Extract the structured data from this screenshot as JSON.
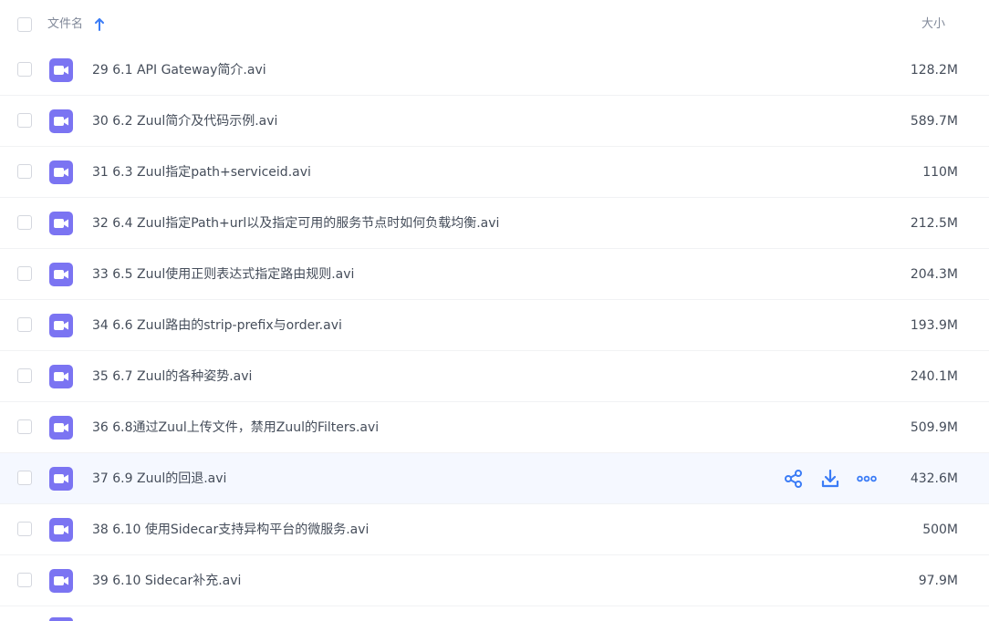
{
  "header": {
    "name_label": "文件名",
    "size_label": "大小",
    "sort_icon": "arrow-up-icon",
    "accent_color": "#3b7cf6"
  },
  "file_icon": "video-file-icon",
  "file_icon_color": "#7b74f2",
  "files": [
    {
      "name": "29 6.1 API Gateway简介.avi",
      "size": "128.2M"
    },
    {
      "name": "30 6.2 Zuul简介及代码示例.avi",
      "size": "589.7M"
    },
    {
      "name": "31 6.3 Zuul指定path+serviceid.avi",
      "size": "110M"
    },
    {
      "name": "32 6.4 Zuul指定Path+url以及指定可用的服务节点时如何负载均衡.avi",
      "size": "212.5M"
    },
    {
      "name": "33 6.5 Zuul使用正则表达式指定路由规则.avi",
      "size": "204.3M"
    },
    {
      "name": "34 6.6 Zuul路由的strip-prefix与order.avi",
      "size": "193.9M"
    },
    {
      "name": "35 6.7 Zuul的各种姿势.avi",
      "size": "240.1M"
    },
    {
      "name": "36 6.8通过Zuul上传文件，禁用Zuul的Filters.avi",
      "size": "509.9M"
    },
    {
      "name": "37 6.9 Zuul的回退.avi",
      "size": "432.6M",
      "hovered": true
    },
    {
      "name": "38 6.10 使用Sidecar支持异构平台的微服务.avi",
      "size": "500M"
    },
    {
      "name": "39 6.10 Sidecar补充.avi",
      "size": "97.9M"
    }
  ],
  "row_actions": {
    "share_icon": "share-icon",
    "download_icon": "download-icon",
    "more_icon": "more-icon"
  }
}
